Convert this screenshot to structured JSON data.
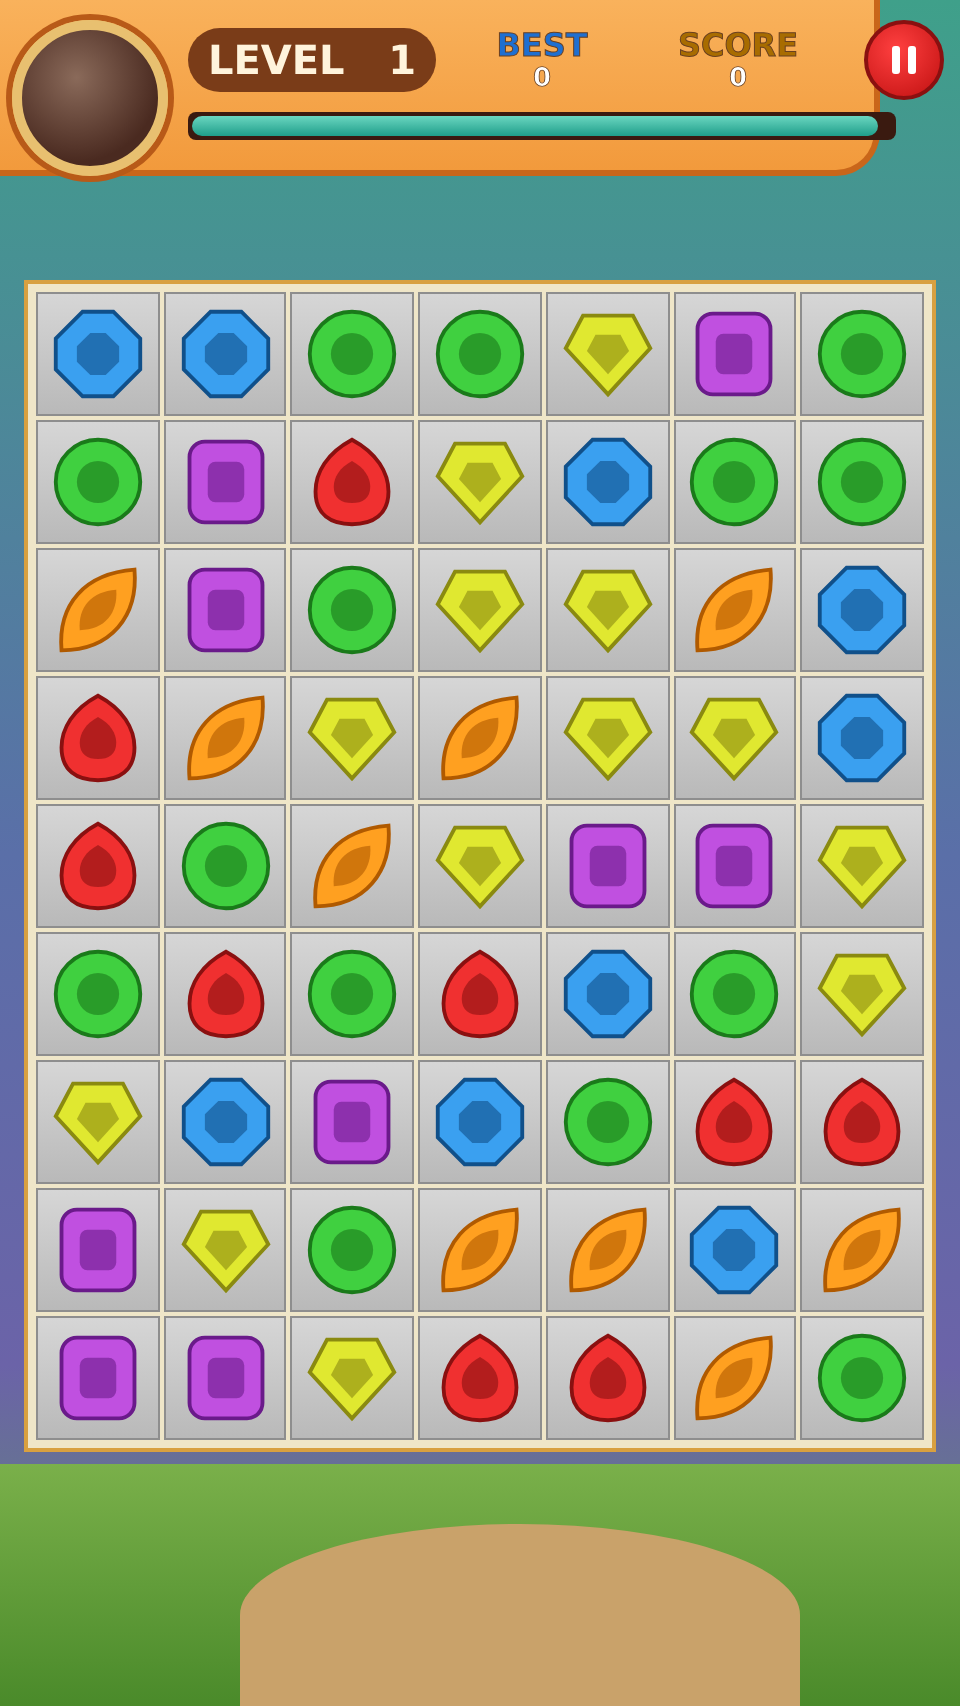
{
  "header": {
    "level_label": "LEVEL",
    "level": "1",
    "best_label": "BEST",
    "best": "0",
    "score_label": "SCORE",
    "score": "0",
    "progress": {
      "level": 0.98
    }
  },
  "board": {
    "rows": [
      [
        {
          "kind": "octagon"
        },
        {
          "kind": "octagon"
        },
        {
          "kind": "circle"
        },
        {
          "kind": "circle"
        },
        {
          "kind": "pentagon"
        },
        {
          "kind": "square"
        },
        {
          "kind": "circle"
        }
      ],
      [
        {
          "kind": "circle"
        },
        {
          "kind": "square"
        },
        {
          "kind": "drop"
        },
        {
          "kind": "pentagon"
        },
        {
          "kind": "octagon"
        },
        {
          "kind": "circle"
        },
        {
          "kind": "circle"
        }
      ],
      [
        {
          "kind": "leaf"
        },
        {
          "kind": "square"
        },
        {
          "kind": "circle"
        },
        {
          "kind": "pentagon"
        },
        {
          "kind": "pentagon"
        },
        {
          "kind": "leaf"
        },
        {
          "kind": "octagon"
        }
      ],
      [
        {
          "kind": "drop"
        },
        {
          "kind": "leaf"
        },
        {
          "kind": "pentagon"
        },
        {
          "kind": "leaf"
        },
        {
          "kind": "pentagon"
        },
        {
          "kind": "pentagon"
        },
        {
          "kind": "octagon"
        }
      ],
      [
        {
          "kind": "drop"
        },
        {
          "kind": "circle"
        },
        {
          "kind": "leaf"
        },
        {
          "kind": "pentagon"
        },
        {
          "kind": "square"
        },
        {
          "kind": "square"
        },
        {
          "kind": "pentagon"
        }
      ],
      [
        {
          "kind": "circle"
        },
        {
          "kind": "drop"
        },
        {
          "kind": "circle"
        },
        {
          "kind": "drop"
        },
        {
          "kind": "octagon"
        },
        {
          "kind": "circle"
        },
        {
          "kind": "pentagon"
        }
      ],
      [
        {
          "kind": "pentagon"
        },
        {
          "kind": "octagon"
        },
        {
          "kind": "square"
        },
        {
          "kind": "octagon"
        },
        {
          "kind": "circle"
        },
        {
          "kind": "drop"
        },
        {
          "kind": "drop"
        }
      ],
      [
        {
          "kind": "square"
        },
        {
          "kind": "pentagon"
        },
        {
          "kind": "circle"
        },
        {
          "kind": "leaf"
        },
        {
          "kind": "leaf"
        },
        {
          "kind": "octagon"
        },
        {
          "kind": "leaf"
        }
      ],
      [
        {
          "kind": "square"
        },
        {
          "kind": "square"
        },
        {
          "kind": "pentagon"
        },
        {
          "kind": "drop"
        },
        {
          "kind": "drop"
        },
        {
          "kind": "leaf"
        },
        {
          "kind": "circle"
        }
      ]
    ]
  }
}
